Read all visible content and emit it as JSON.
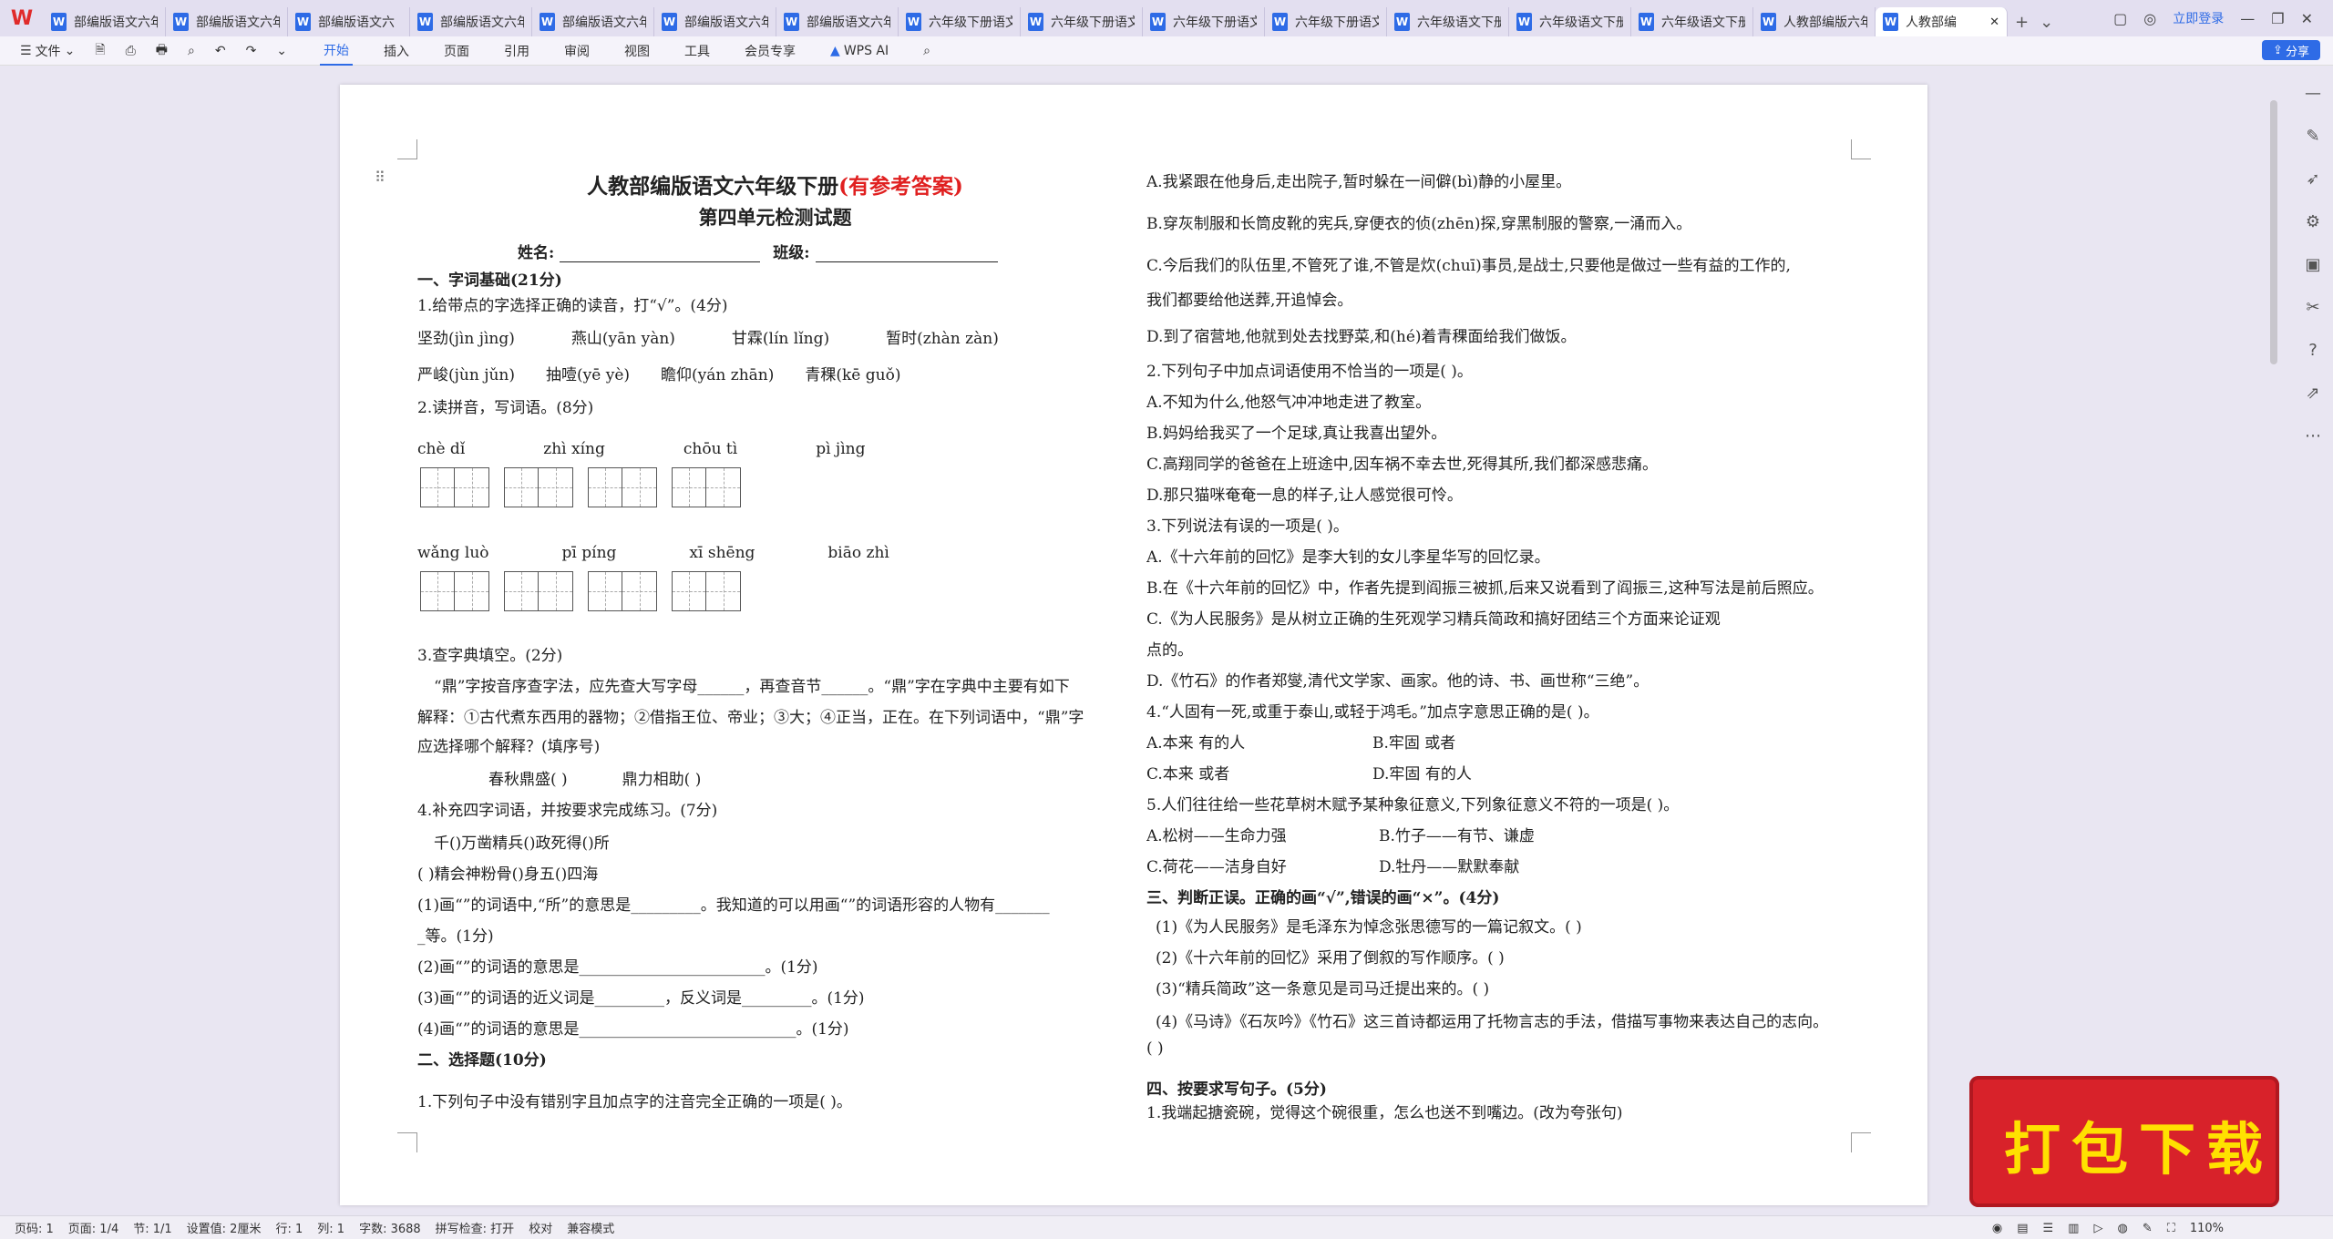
{
  "titlebar": {
    "tabs": [
      "部编版语文六年级",
      "部编版语文六年级",
      "部编版语文六",
      "部编版语文六年级",
      "部编版语文六年级",
      "部编版语文六年级",
      "部编版语文六年级",
      "六年级下册语文",
      "六年级下册语文",
      "六年级下册语文",
      "六年级下册语文",
      "六年级语文下册",
      "六年级语文下册",
      "六年级语文下册",
      "人教部编版六年"
    ],
    "active_tab": "人教部编",
    "login": "立即登录",
    "new_tab": "+"
  },
  "toolbar": {
    "file": "文件",
    "tabs": [
      "开始",
      "插入",
      "页面",
      "引用",
      "审阅",
      "视图",
      "工具",
      "会员专享"
    ],
    "active": "开始",
    "ai": "WPS AI",
    "share": "分享"
  },
  "doc": {
    "left": {
      "title": "人教部编版语文六年级下册",
      "title_red": "(有参考答案)",
      "subtitle": "第四单元检测试题",
      "name_label": "姓名:",
      "class_label": "班级:",
      "sec1": "一、字词基础(21分)",
      "q1": "1.给带点的字选择正确的读音，打“√”。(4分)",
      "q1_row1": [
        "坚劲(jìn  jìng)",
        "燕山(yān  yàn)",
        "甘霖(lín  lǐng)",
        "暂时(zhàn  zàn)"
      ],
      "q1_row2": [
        "严峻(jùn  jǔn)",
        "抽噎(yē  yè)",
        "瞻仰(yán  zhān)",
        "青稞(kē  guǒ)"
      ],
      "q2": "2.读拼音，写词语。(8分)",
      "py_row1": [
        "chè  dǐ",
        "zhì  xíng",
        "chōu  tì",
        "pì  jìng"
      ],
      "py_row2": [
        "wǎng  luò",
        "pī  píng",
        "xī  shēng",
        "biāo  zhì"
      ],
      "q3": "3.查字典填空。(2分)",
      "q3_p1": "“鼎”字按音序查字法，应先查大写字母______，再查音节______。“鼎”字在字典中主要有如下",
      "q3_p2": "解释：①古代煮东西用的器物；②借指王位、帝业；③大；④正当，正在。在下列词语中，“鼎”字",
      "q3_p3": "应选择哪个解释？(填序号)",
      "q3_items": [
        "春秋鼎盛(    )",
        "鼎力相助(    )"
      ],
      "q4": "4.补充四字词语，并按要求完成练习。(7分)",
      "q4_row1": "千()万凿精兵()政死得()所",
      "q4_row2": "(  )精会神粉骨()身五()四海",
      "q4_a": "(1)画“”的词语中,“所”的意思是_________。我知道的可以用画“”的词语形容的人物有_______",
      "q4_a2": "_等。(1分)",
      "q4_b": "(2)画“”的词语的意思是________________________。(1分)",
      "q4_c": "(3)画“”的词语的近义词是_________，反义词是_________。(1分)",
      "q4_d": "(4)画“”的词语的意思是____________________________。(1分)",
      "sec2": "二、选择题(10分)",
      "s2q1": "1.下列句子中没有错别字且加点字的注音完全正确的一项是(      )。"
    },
    "right": {
      "a1": "A.我紧跟在他身后,走出院子,暂时躲在一间僻(bì)静的小屋里。",
      "a2": "B.穿灰制服和长筒皮靴的宪兵,穿便衣的侦(zhēn)探,穿黑制服的警察,一涌而入。",
      "a3": "C.今后我们的队伍里,不管死了谁,不管是炊(chuī)事员,是战士,只要他是做过一些有益的工作的,",
      "a3b": "我们都要给他送葬,开追悼会。",
      "a4": "D.到了宿营地,他就到处去找野菜,和(hé)着青稞面给我们做饭。",
      "q2": "2.下列句子中加点词语使用不恰当的一项是(      )。",
      "q2_opts": [
        "A.不知为什么,他怒气冲冲地走进了教室。",
        "B.妈妈给我买了一个足球,真让我喜出望外。",
        "C.高翔同学的爸爸在上班途中,因车祸不幸去世,死得其所,我们都深感悲痛。",
        "D.那只猫咪奄奄一息的样子,让人感觉很可怜。"
      ],
      "q3": "3.下列说法有误的一项是(      )。",
      "q3_opts": [
        "A.《十六年前的回忆》是李大钊的女儿李星华写的回忆录。",
        "B.在《十六年前的回忆》中，作者先提到阎振三被抓,后来又说看到了阎振三,这种写法是前后照应。",
        "C.《为人民服务》是从树立正确的生死观学习精兵简政和搞好团结三个方面来论证观",
        "点的。",
        "D.《竹石》的作者郑燮,清代文学家、画家。他的诗、书、画世称“三绝”。"
      ],
      "q4": "4.“人固有一死,或重于泰山,或轻于鸿毛。”加点字意思正确的是(        )。",
      "q4_opts": [
        "A.本来    有的人",
        "B.牢固    或者",
        "C.本来    或者",
        "D.牢固    有的人"
      ],
      "q5": "5.人们往往给一些花草树木赋予某种象征意义,下列象征意义不符的一项是(      )。",
      "q5_opts": [
        "A.松树——生命力强",
        "B.竹子——有节、谦虚",
        "C.荷花——洁身自好",
        "D.牡丹——默默奉献"
      ],
      "sec3": "三、判断正误。正确的画“√”,错误的画“×”。(4分)",
      "sec3_items": [
        "(1)《为人民服务》是毛泽东为悼念张思德写的一篇记叙文。(      )",
        "(2)《十六年前的回忆》采用了倒叙的写作顺序。(      )",
        "(3)“精兵简政”这一条意见是司马迁提出来的。(      )",
        "(4)《马诗》《石灰吟》《竹石》这三首诗都运用了托物言志的手法，借描写事物来表达自己的志向。",
        "(      )"
      ],
      "sec4": "四、按要求写句子。(5分)",
      "s4q1": "1.我端起搪瓷碗，觉得这个碗很重，怎么也送不到嘴边。(改为夸张句)"
    }
  },
  "statusbar": {
    "page_code": "页码: 1",
    "page": "页面: 1/4",
    "section": "节: 1/1",
    "setting": "设置值: 2厘米",
    "row": "行: 1",
    "col": "列: 1",
    "words": "字数: 3688",
    "spell": "拼写检查: 打开",
    "proof": "校对",
    "compat": "兼容模式",
    "zoom": "110%"
  },
  "promo": "打包下载"
}
